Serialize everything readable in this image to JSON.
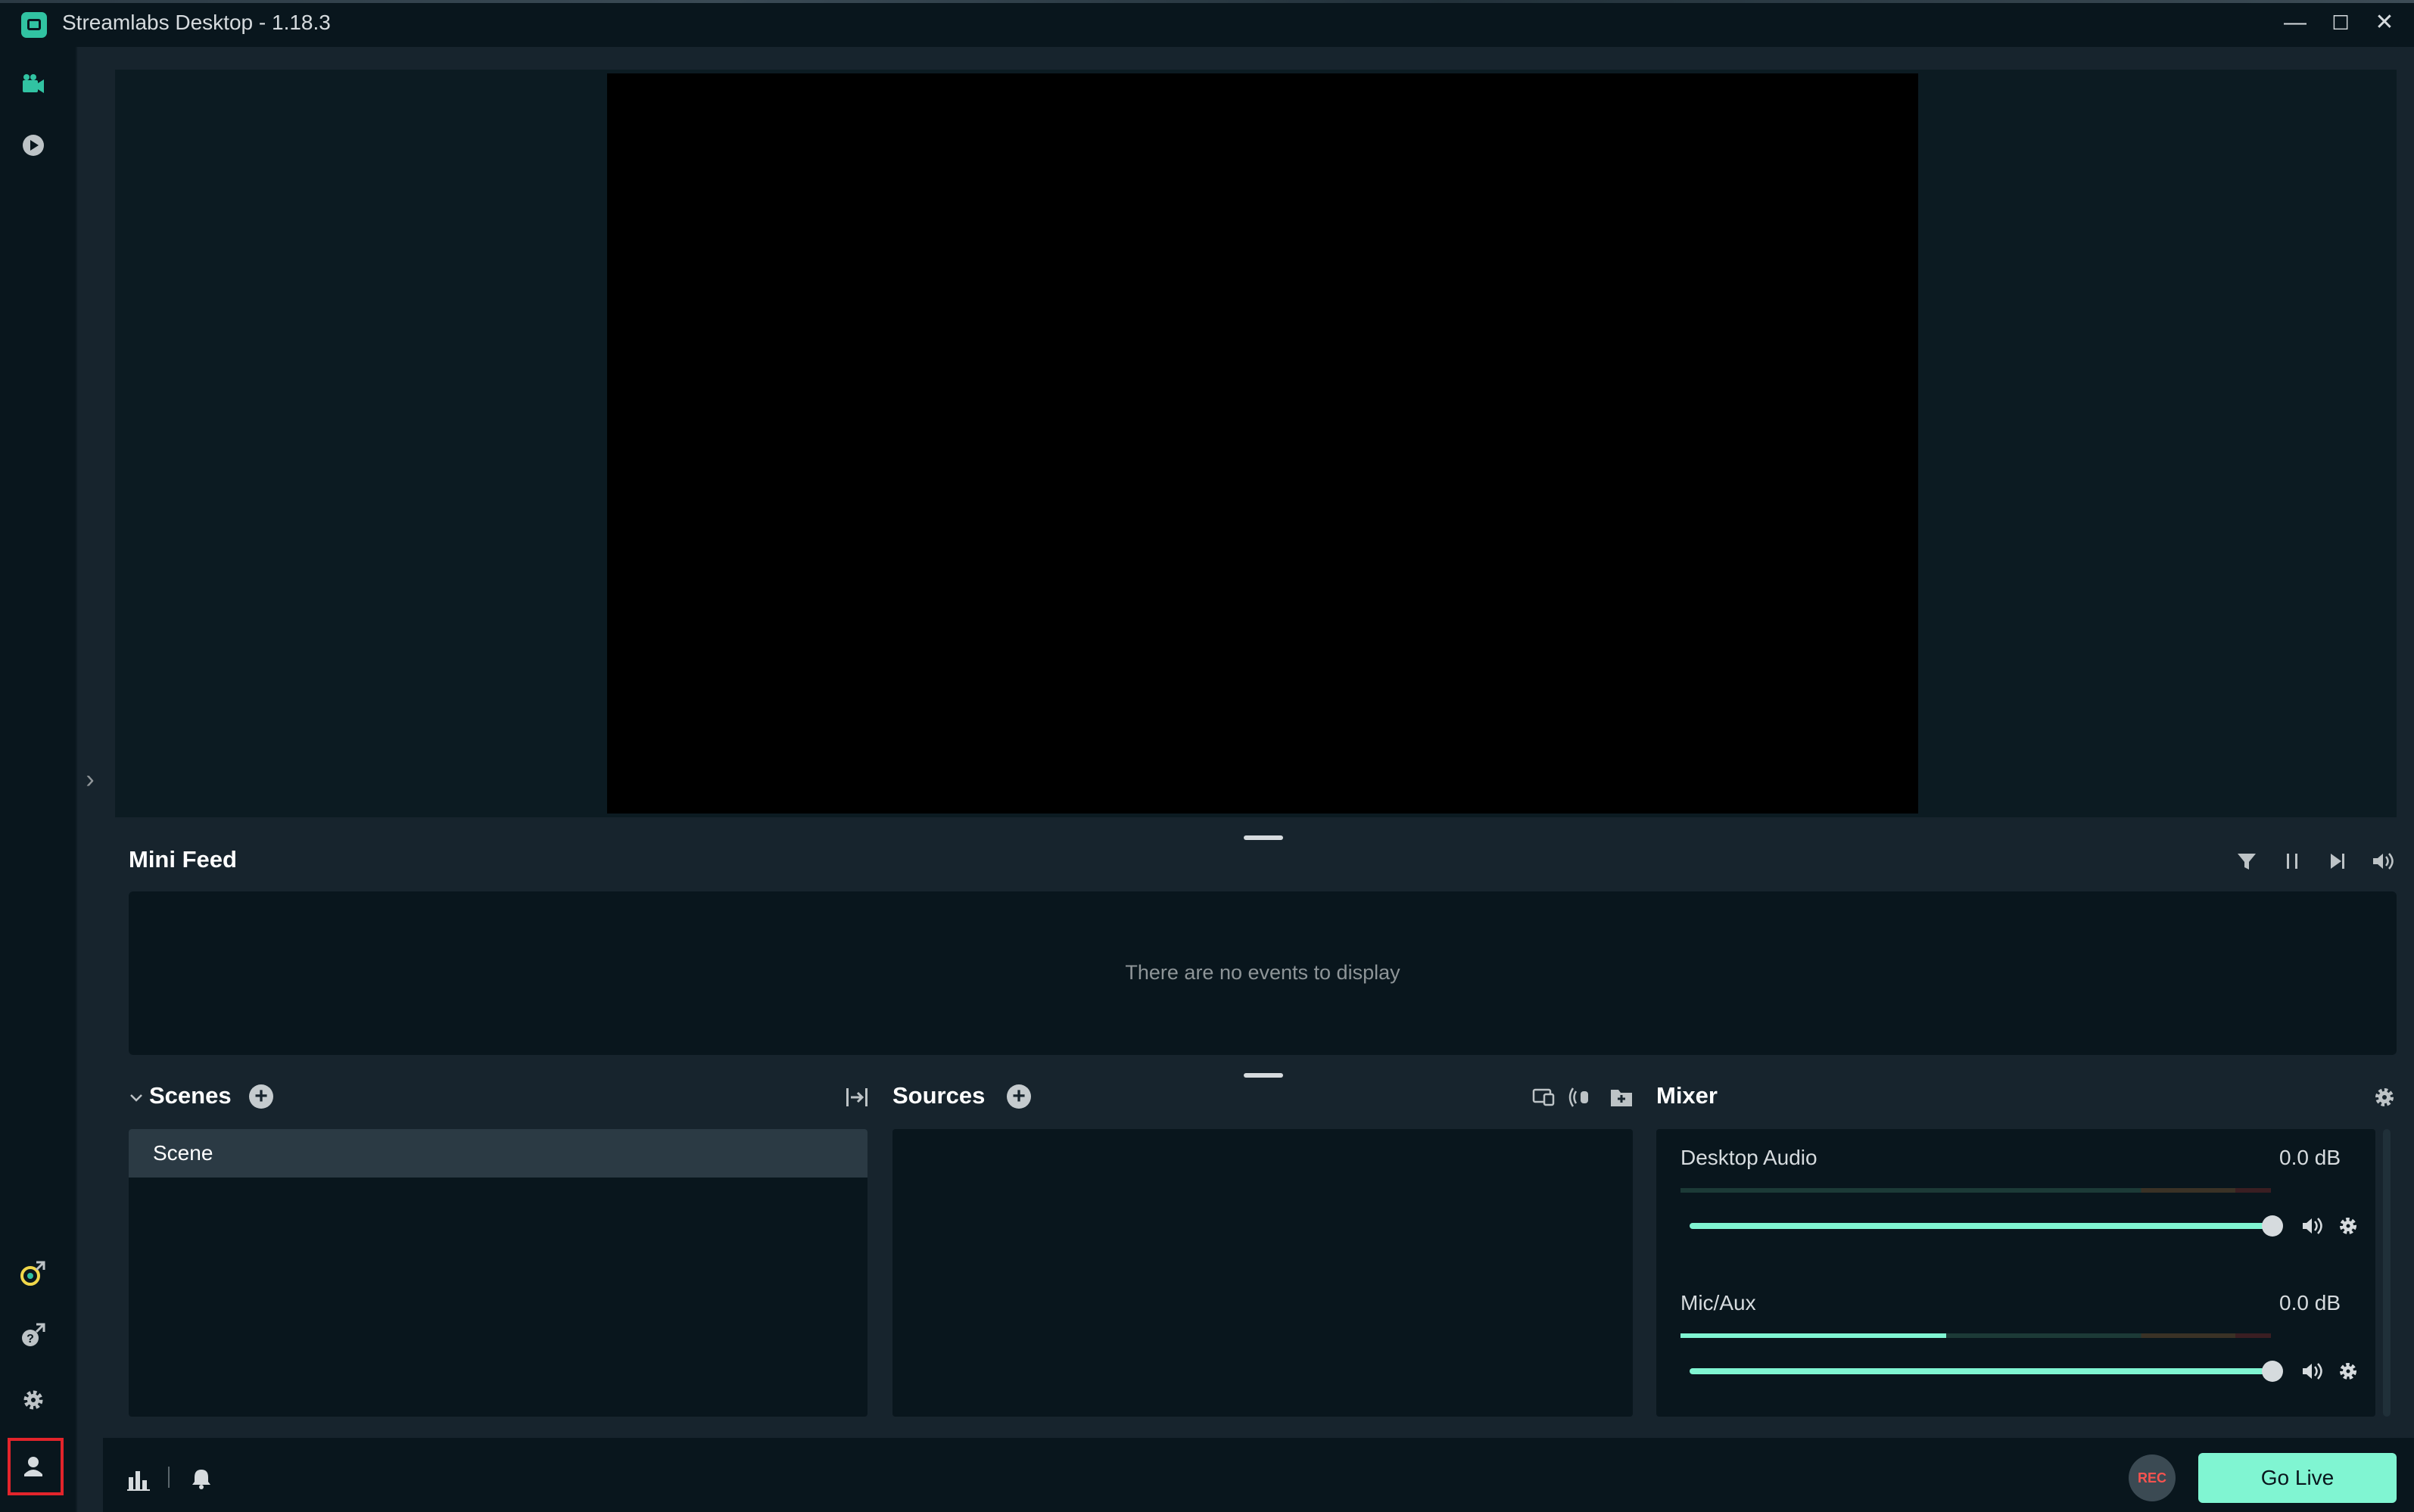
{
  "window": {
    "title": "Streamlabs Desktop - 1.18.3",
    "controls": {
      "minimize": "—",
      "maximize": "☐",
      "close": "✕"
    }
  },
  "nav": {
    "top_items": [
      {
        "name": "editor",
        "icon": "camera-icon"
      },
      {
        "name": "recording-history",
        "icon": "play-circle-icon"
      }
    ],
    "bottom_items": [
      {
        "name": "streamlabs-ultra",
        "icon": "link-external-icon"
      },
      {
        "name": "help",
        "icon": "help-external-icon"
      },
      {
        "name": "settings",
        "icon": "gear-icon"
      },
      {
        "name": "profile",
        "icon": "user-icon"
      }
    ],
    "collapse_glyph": "›"
  },
  "mini_feed": {
    "title": "Mini Feed",
    "empty_text": "There are no events to display",
    "controls": [
      "filter-icon",
      "pause-icon",
      "skip-icon",
      "volume-icon"
    ]
  },
  "scenes": {
    "title": "Scenes",
    "items": [
      {
        "label": "Scene",
        "selected": true
      }
    ]
  },
  "sources": {
    "title": "Sources",
    "items": []
  },
  "mixer": {
    "title": "Mixer",
    "channels": [
      {
        "label": "Desktop Audio",
        "db": "0.0 dB",
        "level": 0.0,
        "volume": 1.0
      },
      {
        "label": "Mic/Aux",
        "db": "0.0 dB",
        "level": 0.45,
        "volume": 1.0
      }
    ]
  },
  "footer": {
    "rec_label": "REC",
    "go_live_label": "Go Live"
  },
  "colors": {
    "accent": "#80f5d2",
    "background": "#17242d",
    "panel": "#09161d",
    "highlight_box": "#e3242b"
  }
}
